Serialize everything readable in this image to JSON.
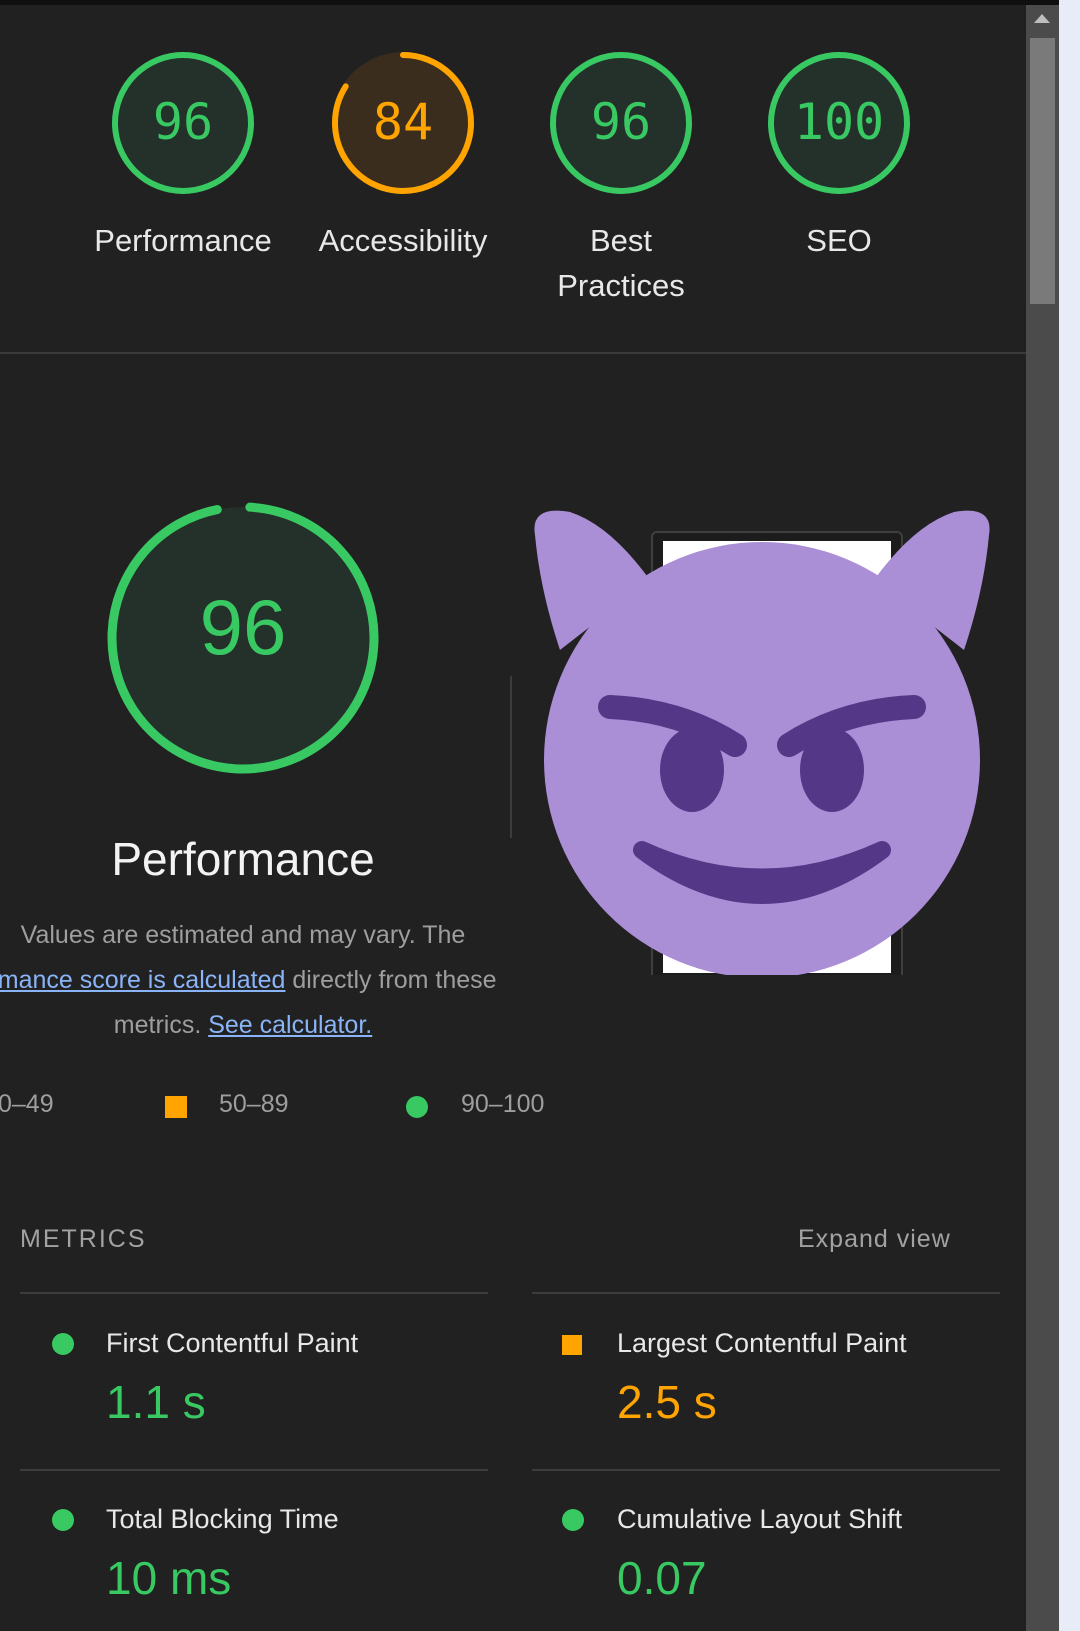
{
  "summary_gauges": [
    {
      "score": "96",
      "label_lines": [
        "Performance"
      ],
      "color": "#39c963",
      "fill": "#24302a"
    },
    {
      "score": "84",
      "label_lines": [
        "Accessibility"
      ],
      "color": "#ffa400",
      "fill": "#3a2d1e"
    },
    {
      "score": "96",
      "label_lines": [
        "Best",
        "Practices"
      ],
      "color": "#39c963",
      "fill": "#24302a"
    },
    {
      "score": "100",
      "label_lines": [
        "SEO"
      ],
      "color": "#39c963",
      "fill": "#24302a"
    }
  ],
  "performance": {
    "score": "96",
    "title": "Performance",
    "description": {
      "line1": "Values are estimated and may vary. The",
      "link1": "rmance score is calculated",
      "line2_rest": " directly from these",
      "line3_start": "metrics. ",
      "link2": "See calculator."
    },
    "legend": [
      {
        "range": "0–49",
        "shape": "triangle",
        "color": "#ff4e42"
      },
      {
        "range": "50–89",
        "shape": "square",
        "color": "#ffa400"
      },
      {
        "range": "90–100",
        "shape": "circle",
        "color": "#39c963"
      }
    ]
  },
  "metrics": {
    "header": "METRICS",
    "expand_label": "Expand view",
    "items": [
      {
        "label": "First Contentful Paint",
        "value": "1.1 s",
        "status": "pass",
        "color": "#39c963"
      },
      {
        "label": "Largest Contentful Paint",
        "value": "2.5 s",
        "status": "average",
        "color": "#ffa400"
      },
      {
        "label": "Total Blocking Time",
        "value": "10 ms",
        "status": "pass",
        "color": "#39c963"
      },
      {
        "label": "Cumulative Layout Shift",
        "value": "0.07",
        "status": "pass",
        "color": "#39c963"
      }
    ]
  },
  "overlay": {
    "icon": "smiling-devil-emoji-icon",
    "color": "#aa8ed6"
  }
}
